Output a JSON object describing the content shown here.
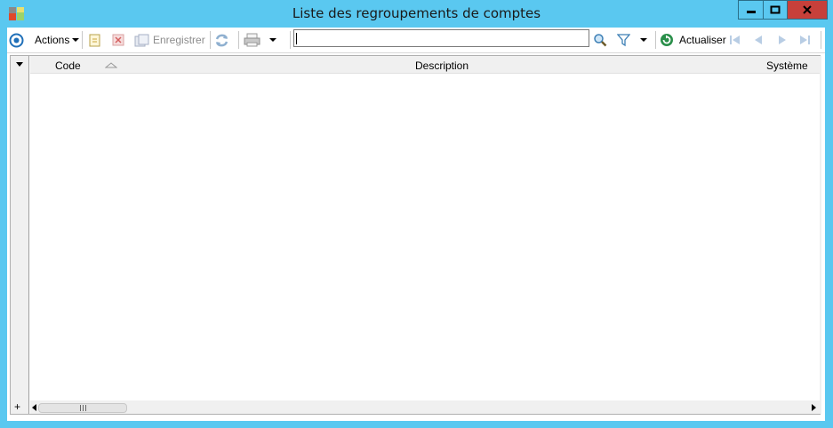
{
  "window": {
    "title": "Liste des regroupements de comptes"
  },
  "toolbar": {
    "actions_label": "Actions",
    "save_label": "Enregistrer",
    "refresh_label": "Actualiser",
    "search_value": ""
  },
  "grid": {
    "columns": [
      "Code",
      "Description",
      "Système"
    ],
    "rows": []
  },
  "colors": {
    "titlebar": "#5ac8f0",
    "close": "#c7403a"
  }
}
